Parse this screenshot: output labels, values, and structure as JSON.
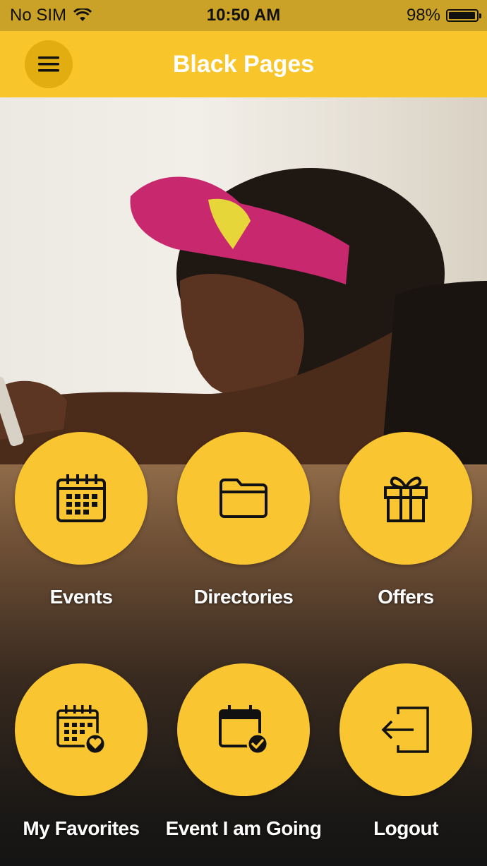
{
  "status": {
    "carrier": "No SIM",
    "time": "10:50 AM",
    "battery_percent": "98%",
    "battery_level": 0.98
  },
  "header": {
    "title": "Black Pages",
    "menu_icon": "hamburger-menu-icon"
  },
  "colors": {
    "accent": "#f8c52a",
    "status_bar": "#c9a227",
    "icon": "#111111"
  },
  "menu": {
    "items": [
      {
        "label": "Events",
        "icon": "calendar-icon"
      },
      {
        "label": "Directories",
        "icon": "folder-icon"
      },
      {
        "label": "Offers",
        "icon": "gift-icon"
      },
      {
        "label": "My Favorites",
        "icon": "calendar-heart-icon"
      },
      {
        "label": "Event I am Going",
        "icon": "calendar-check-icon"
      },
      {
        "label": "Logout",
        "icon": "logout-icon"
      }
    ]
  }
}
